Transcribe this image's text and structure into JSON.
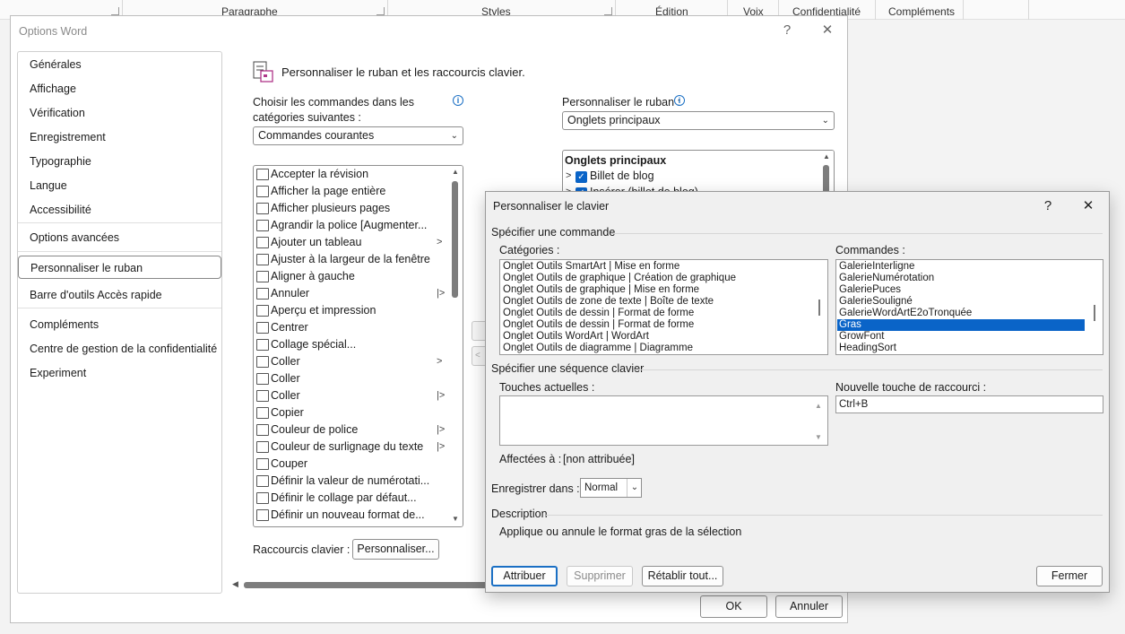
{
  "ribbon": {
    "groups": [
      "Paragraphe",
      "Styles",
      "Édition",
      "Voix",
      "Confidentialité",
      "Compléments"
    ]
  },
  "options_dialog": {
    "title": "Options Word",
    "help_label": "?",
    "close_label": "✕",
    "nav": [
      "Générales",
      "Affichage",
      "Vérification",
      "Enregistrement",
      "Typographie",
      "Langue",
      "Accessibilité",
      "Options avancées",
      "Personnaliser le ruban",
      "Barre d'outils Accès rapide",
      "Compléments",
      "Centre de gestion de la confidentialité",
      "Experiment"
    ],
    "selected_nav": "Personnaliser le ruban",
    "heading": "Personnaliser le ruban et les raccourcis clavier.",
    "choose_label_1": "Choisir les commandes dans les",
    "choose_label_2": "catégories suivantes :",
    "choose_value": "Commandes courantes",
    "customize_label": "Personnaliser le ruban :",
    "customize_value": "Onglets principaux",
    "commands": [
      {
        "label": "Accepter la révision",
        "arrow": ""
      },
      {
        "label": "Afficher la page entière",
        "arrow": ""
      },
      {
        "label": "Afficher plusieurs pages",
        "arrow": ""
      },
      {
        "label": "Agrandir la police [Augmenter...",
        "arrow": ""
      },
      {
        "label": "Ajouter un tableau",
        "arrow": ">"
      },
      {
        "label": "Ajuster à la largeur de la fenêtre",
        "arrow": ""
      },
      {
        "label": "Aligner à gauche",
        "arrow": ""
      },
      {
        "label": "Annuler",
        "arrow": "|>"
      },
      {
        "label": "Aperçu et impression",
        "arrow": ""
      },
      {
        "label": "Centrer",
        "arrow": ""
      },
      {
        "label": "Collage spécial...",
        "arrow": ""
      },
      {
        "label": "Coller",
        "arrow": ">"
      },
      {
        "label": "Coller",
        "arrow": ""
      },
      {
        "label": "Coller",
        "arrow": "|>"
      },
      {
        "label": "Copier",
        "arrow": ""
      },
      {
        "label": "Couleur de police",
        "arrow": "|>"
      },
      {
        "label": "Couleur de surlignage du texte",
        "arrow": "|>"
      },
      {
        "label": "Couper",
        "arrow": ""
      },
      {
        "label": "Définir la valeur de numérotati...",
        "arrow": ""
      },
      {
        "label": "Définir le collage par défaut...",
        "arrow": ""
      },
      {
        "label": "Définir un nouveau format de...",
        "arrow": ""
      }
    ],
    "tabs_header": "Onglets principaux",
    "tabs": [
      {
        "label": "Billet de blog",
        "checked": true
      },
      {
        "label": "Insérer (billet de blog)",
        "checked": true
      }
    ],
    "shortcuts_label": "Raccourcis clavier :",
    "customize_button": "Personnaliser...",
    "ok_label": "OK",
    "cancel_label": "Annuler"
  },
  "keyboard_dialog": {
    "title": "Personnaliser le clavier",
    "help_label": "?",
    "close_label": "✕",
    "specify_command": "Spécifier une commande",
    "categories_label": "Catégories :",
    "categories": [
      "Onglet Outils SmartArt | Mise en forme",
      "Onglet Outils de graphique | Création de graphique",
      "Onglet Outils de graphique | Mise en forme",
      "Onglet Outils de zone de texte | Boîte de texte",
      "Onglet Outils de dessin | Format de forme",
      "Onglet Outils de dessin | Format de forme",
      "Onglet Outils WordArt | WordArt",
      "Onglet Outils de diagramme | Diagramme"
    ],
    "commands_label": "Commandes :",
    "commands": [
      "GalerieInterligne",
      "GalerieNumérotation",
      "GaleriePuces",
      "GalerieSouligné",
      "GalerieWordArtE2oTronquée",
      "Gras",
      "GrowFont",
      "HeadingSort"
    ],
    "selected_command": "Gras",
    "specify_sequence": "Spécifier une séquence clavier",
    "current_keys_label": "Touches actuelles :",
    "new_key_label": "Nouvelle touche de raccourci :",
    "new_key_value": "Ctrl+B",
    "assigned_label": "Affectées à :",
    "assigned_value": "[non attribuée]",
    "save_in_label": "Enregistrer dans :",
    "save_in_value": "Normal",
    "description_label": "Description",
    "description_text": "Applique ou annule le format gras de la sélection",
    "assign_button": "Attribuer",
    "remove_button": "Supprimer",
    "reset_button": "Rétablir tout...",
    "close_button": "Fermer"
  }
}
